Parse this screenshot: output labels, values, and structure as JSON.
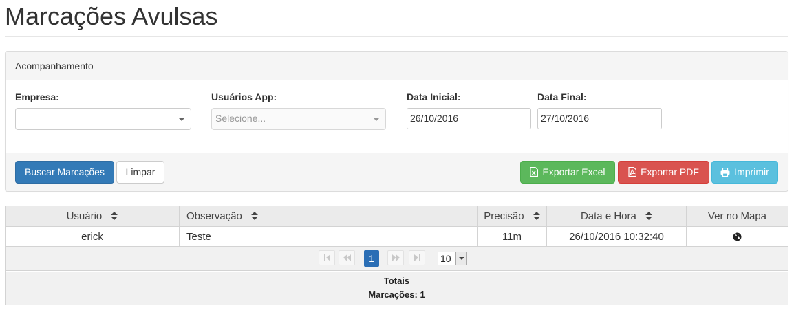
{
  "page": {
    "title": "Marcações Avulsas"
  },
  "panel": {
    "heading": "Acompanhamento",
    "fields": {
      "empresa": {
        "label": "Empresa:",
        "value": ""
      },
      "usuarios_app": {
        "label": "Usuários App:",
        "placeholder": "Selecione..."
      },
      "data_inicial": {
        "label": "Data Inicial:",
        "value": "26/10/2016"
      },
      "data_final": {
        "label": "Data Final:",
        "value": "27/10/2016"
      }
    },
    "buttons": {
      "buscar": "Buscar Marcações",
      "limpar": "Limpar",
      "exportar_excel": "Exportar Excel",
      "exportar_pdf": "Exportar PDF",
      "imprimir": "Imprimir"
    }
  },
  "grid": {
    "columns": [
      "Usuário",
      "Observação",
      "Precisão",
      "Data e Hora",
      "Ver no Mapa"
    ],
    "rows": [
      {
        "usuario": "erick",
        "observacao": "Teste",
        "precisao": "11m",
        "data_hora": "26/10/2016 10:32:40",
        "mapa_icon": "globe-icon"
      }
    ],
    "pager": {
      "current_page": "1",
      "page_size": "10"
    },
    "totals": {
      "title": "Totais",
      "marcacoes": "Marcações: 1"
    }
  },
  "colors": {
    "primary": "#337ab7",
    "success": "#5cb85c",
    "danger": "#d9534f",
    "info": "#5bc0de",
    "pager_active": "#2a6eb5"
  }
}
